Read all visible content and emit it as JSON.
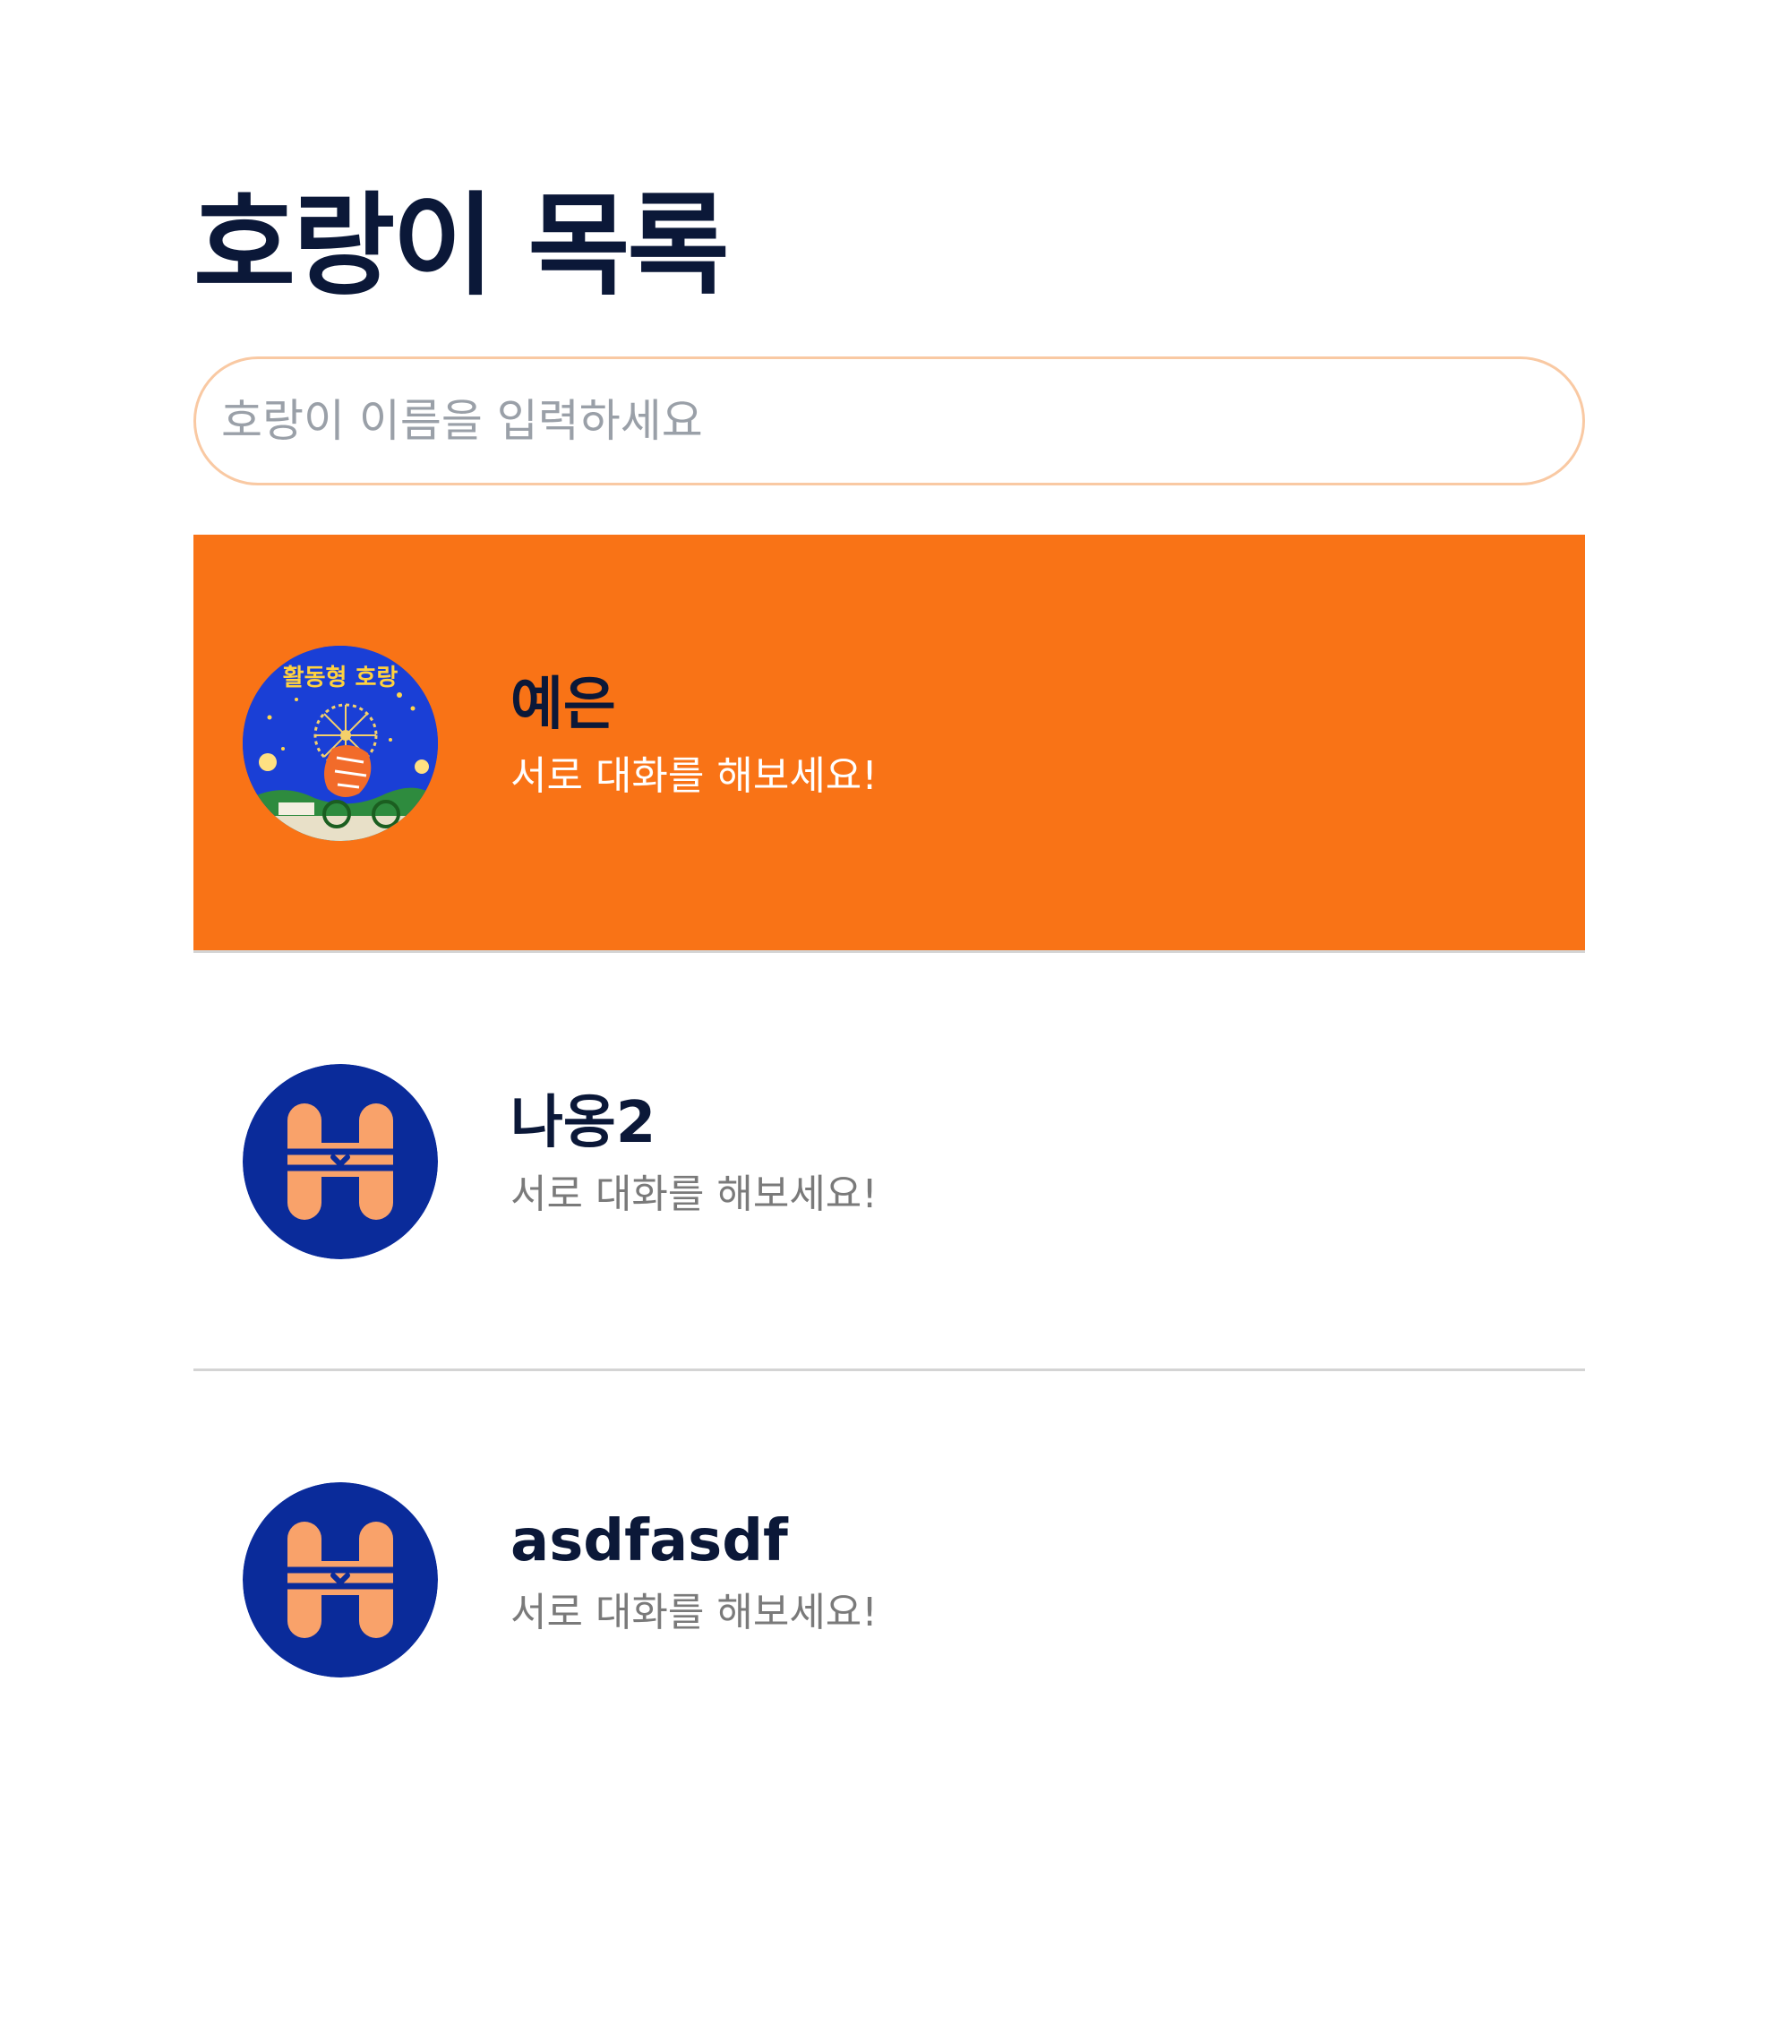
{
  "header": {
    "title": "호랑이 목록"
  },
  "search": {
    "placeholder": "호랑이 이름을 입력하세요",
    "value": ""
  },
  "colors": {
    "selected_background": "#f97316",
    "title_text": "#0b1838",
    "secondary_text": "#7a7a7a",
    "search_border": "#f9c9a3",
    "avatar_navy": "#0a2b9a",
    "avatar_orange": "#f9a26a"
  },
  "tigers": [
    {
      "name": "예은",
      "message": "서로 대화를 해보세요!",
      "selected": true,
      "avatar": "festival-poster-image",
      "avatar_text": "활동형 호랑"
    },
    {
      "name": "나옹2",
      "message": "서로 대화를 해보세요!",
      "selected": false,
      "avatar": "default-h-logo-icon"
    },
    {
      "name": "asdfasdf",
      "message": "서로 대화를 해보세요!",
      "selected": false,
      "avatar": "default-h-logo-icon"
    }
  ]
}
